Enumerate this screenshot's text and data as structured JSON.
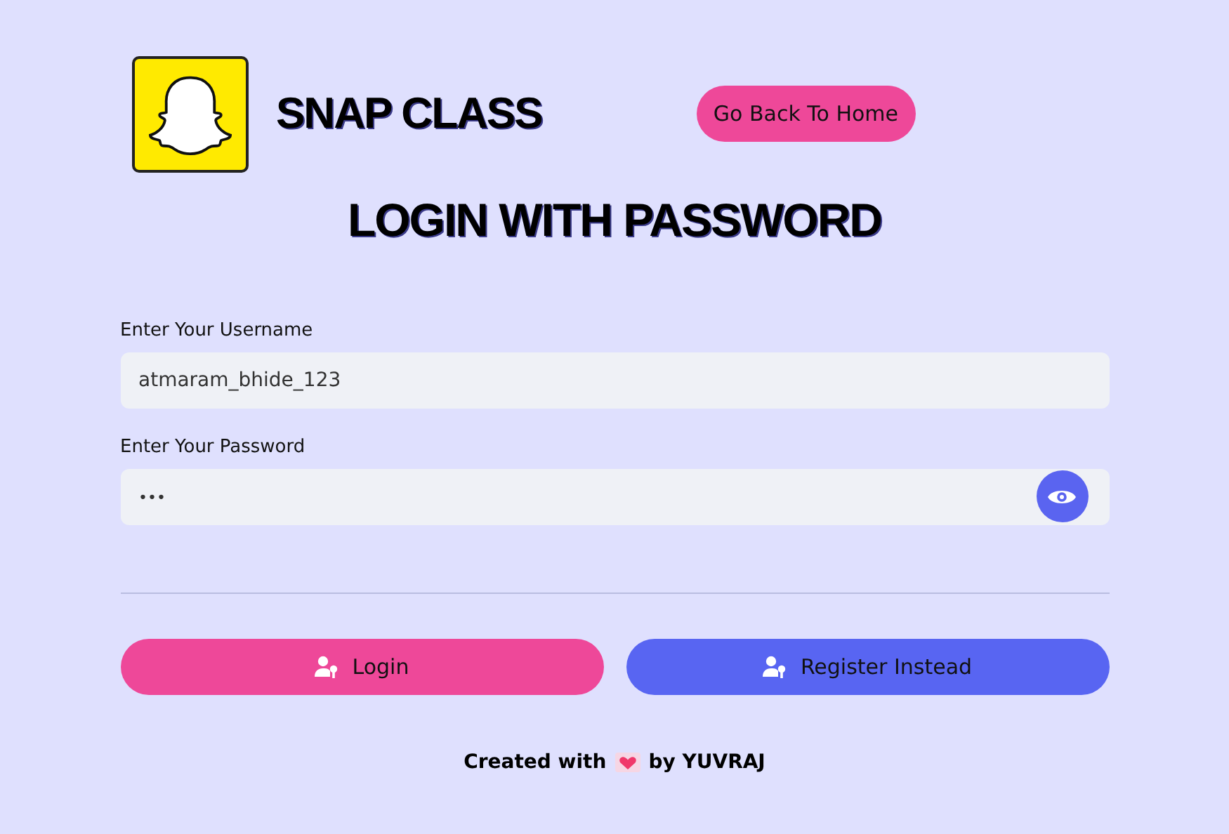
{
  "brand": {
    "title": "SNAP CLASS"
  },
  "home_button": {
    "label": "Go Back To Home"
  },
  "heading": "LOGIN WITH PASSWORD",
  "fields": [
    {
      "label": "Enter Your Username",
      "value": "atmaram_bhide_123",
      "kind": "text"
    },
    {
      "label": "Enter Your Password",
      "value": "•••",
      "kind": "password"
    }
  ],
  "buttons": [
    {
      "label": "Login",
      "kind": "primary"
    },
    {
      "label": "Register Instead",
      "kind": "secondary"
    }
  ],
  "footer": {
    "before": "Created with",
    "after": "by YUVRAJ"
  }
}
